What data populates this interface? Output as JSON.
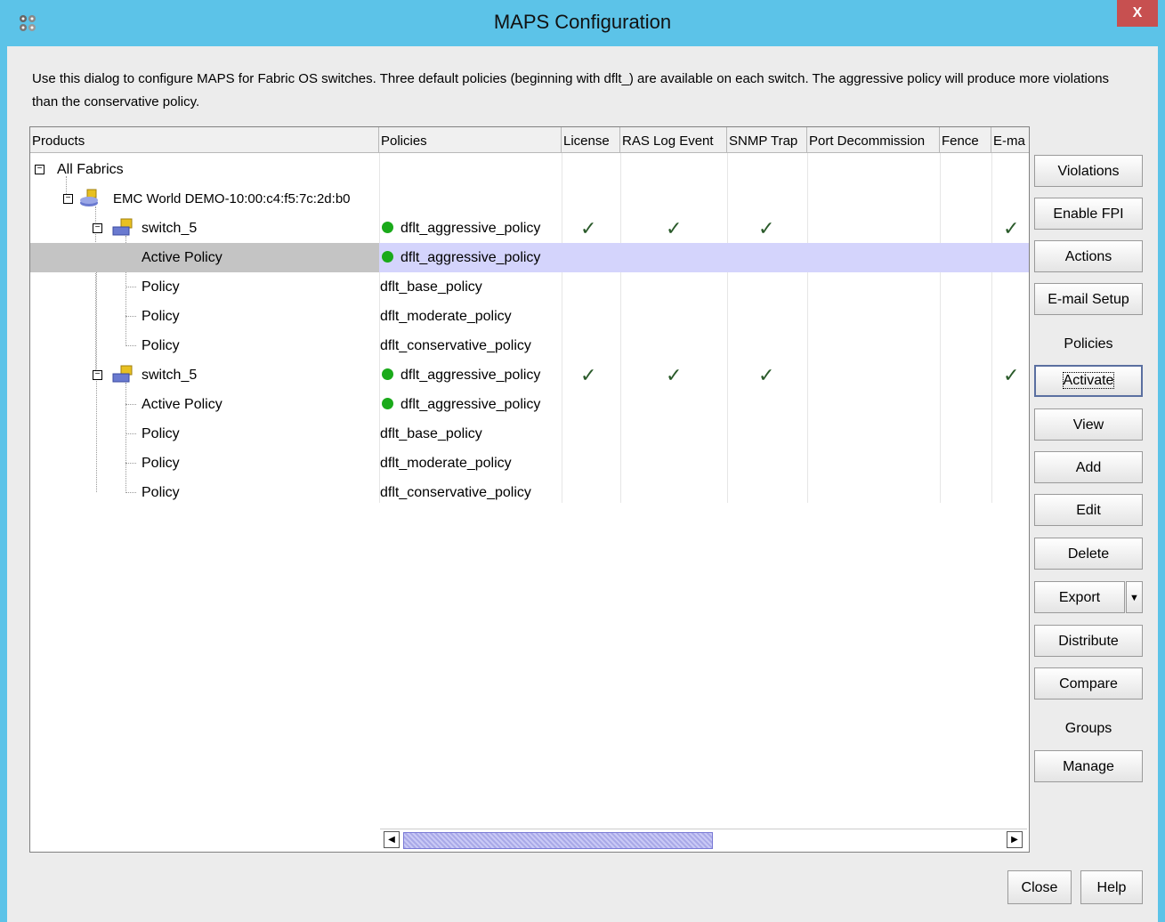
{
  "window": {
    "title": "MAPS Configuration",
    "close_label": "X"
  },
  "description": "Use this dialog to configure MAPS for Fabric OS switches. Three default policies (beginning with dflt_) are available on each switch. The aggressive policy will produce more violations than the conservative policy.",
  "table": {
    "columns": [
      "Products",
      "Policies",
      "License",
      "RAS Log Event",
      "SNMP Trap",
      "Port Decommission",
      "Fence",
      "E-ma"
    ],
    "rows": [
      {
        "product": "All Fabrics",
        "policy": ""
      },
      {
        "product": "EMC World DEMO-10:00:c4:f5:7c:2d:b0",
        "policy": ""
      },
      {
        "product": "switch_5",
        "policy": "dflt_aggressive_policy"
      },
      {
        "product": "Active Policy",
        "policy": "dflt_aggressive_policy"
      },
      {
        "product": "Policy",
        "policy": "dflt_base_policy"
      },
      {
        "product": "Policy",
        "policy": "dflt_moderate_policy"
      },
      {
        "product": "Policy",
        "policy": "dflt_conservative_policy"
      },
      {
        "product": "switch_5",
        "policy": "dflt_aggressive_policy"
      },
      {
        "product": "Active Policy",
        "policy": "dflt_aggressive_policy"
      },
      {
        "product": "Policy",
        "policy": "dflt_base_policy"
      },
      {
        "product": "Policy",
        "policy": "dflt_moderate_policy"
      },
      {
        "product": "Policy",
        "policy": "dflt_conservative_policy"
      }
    ],
    "checkmark": "✓",
    "status_color": "#1aaa1a",
    "selection_color": "#d4d4fc",
    "scroll_position": 0.48
  },
  "buttons": {
    "violations": "Violations",
    "enable_fpi": "Enable FPI",
    "actions": "Actions",
    "email_setup": "E-mail Setup",
    "policies_label": "Policies",
    "activate": "Activate",
    "view": "View",
    "add": "Add",
    "edit": "Edit",
    "delete": "Delete",
    "export": "Export",
    "distribute": "Distribute",
    "compare": "Compare",
    "groups_label": "Groups",
    "manage": "Manage",
    "close": "Close",
    "help": "Help"
  }
}
